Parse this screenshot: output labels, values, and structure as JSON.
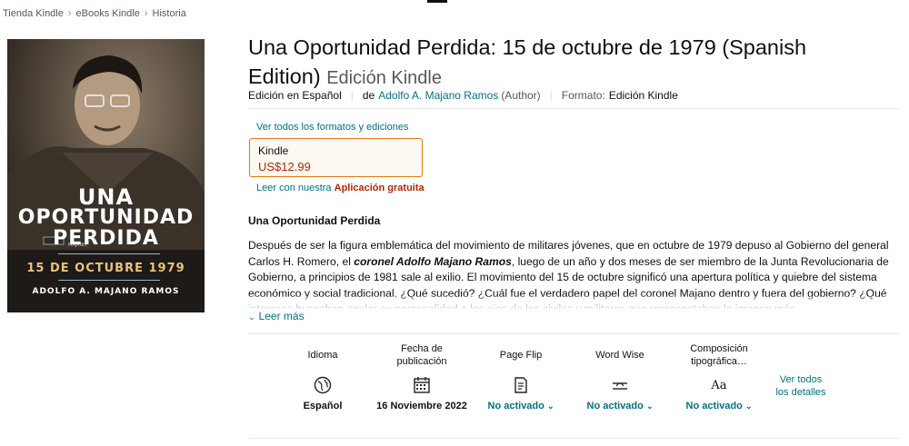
{
  "breadcrumb": [
    "Tienda Kindle",
    "eBooks Kindle",
    "Historia"
  ],
  "cover": {
    "title_line1": "UNA",
    "title_line2": "OPORTUNIDAD",
    "title_line3": "PERDIDA",
    "date": "15 DE OCTUBRE 1979",
    "author": "ADOLFO A. MAJANO RAMOS",
    "badge_text": "MAJANO"
  },
  "product": {
    "title": "Una Oportunidad Perdida: 15 de octubre de 1979 (Spanish Edition)",
    "edition_label": "Edición Kindle",
    "language_label": "Edición en Español",
    "by_label": "de",
    "author": "Adolfo A. Majano Ramos",
    "author_role": "(Author)",
    "format_label": "Formato:",
    "format_value": "Edición Kindle"
  },
  "formats": {
    "see_all": "Ver todos los formatos y ediciones",
    "selected_name": "Kindle",
    "selected_price": "US$12.99",
    "read_with": "Leer con nuestra",
    "app_link": "Aplicación gratuita"
  },
  "description": {
    "heading": "Una Oportunidad Perdida",
    "part1": "Después de ser la figura emblemática del movimiento de militares jóvenes, que en octubre de 1979 depuso al Gobierno del general Carlos H. Romero, el ",
    "emph": "coronel Adolfo Majano Ramos",
    "part2": ", luego de un año y dos meses de ser miembro de la Junta Revolucionaria de Gobierno, a principios de 1981 sale al exilio. El movimiento del 15 de octubre significó una apertura política y quiebre del sistema económico y social tradicional. ¿Qué sucedió? ¿Cuál fue el verdadero papel del coronel Majano dentro y fuera del gobierno? ¿Qué intereses buscaban anular su personalidad a los ojos de los civiles y militares que representaban la imagen más",
    "read_more": "Leer más"
  },
  "details": {
    "items": [
      {
        "label": "Idioma",
        "icon": "globe-icon",
        "value": "Español"
      },
      {
        "label": "Fecha de publicación",
        "icon": "calendar-icon",
        "value": "16 Noviembre 2022"
      },
      {
        "label": "Page Flip",
        "icon": "page-flip-icon",
        "value": "No activado"
      },
      {
        "label": "Word Wise",
        "icon": "word-wise-icon",
        "value": "No activado"
      },
      {
        "label": "Composición tipográfica…",
        "icon": "typesetting-icon",
        "icon_text": "Aa",
        "value": "No activado"
      }
    ],
    "see_all": "Ver todos los detalles"
  },
  "colors": {
    "link": "#007185",
    "price": "#b12704",
    "selected_border": "#e47911"
  }
}
